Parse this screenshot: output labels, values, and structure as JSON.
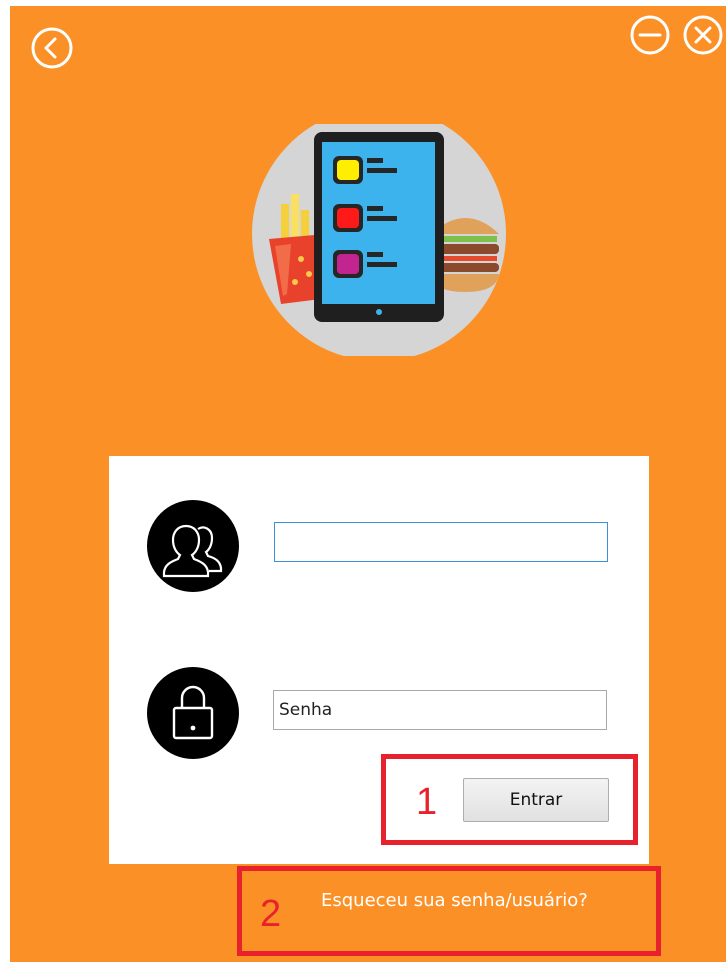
{
  "window": {
    "background": "#fb9027"
  },
  "icons": {
    "back": "chevron-left-icon",
    "minimize": "minus-circle-icon",
    "close": "close-circle-icon",
    "logo": "tablet-food-menu-icon",
    "user": "users-icon",
    "lock": "lock-icon"
  },
  "login": {
    "username_value": "",
    "password_placeholder": "Senha",
    "submit_label": "Entrar",
    "forgot_label": "Esqueceu sua senha/usuário?"
  },
  "annotations": [
    {
      "number": "1"
    },
    {
      "number": "2"
    }
  ],
  "colors": {
    "accent": "#fb9027",
    "annotation": "#e8222c",
    "input_focus": "#3d8fd6"
  }
}
